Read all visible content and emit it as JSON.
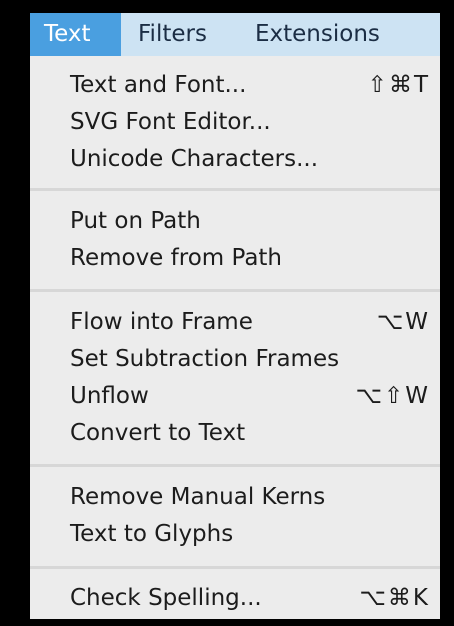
{
  "menubar": {
    "items": [
      {
        "label": "Text",
        "active": true
      },
      {
        "label": "Filters",
        "active": false
      },
      {
        "label": "Extensions",
        "active": false
      }
    ],
    "active_color": "#4a9fe0",
    "bar_color": "#cde3f3"
  },
  "menu": {
    "groups": [
      [
        {
          "label": "Text and Font...",
          "shortcut": "⇧⌘T"
        },
        {
          "label": "SVG Font Editor...",
          "shortcut": ""
        },
        {
          "label": "Unicode Characters...",
          "shortcut": ""
        }
      ],
      [
        {
          "label": "Put on Path",
          "shortcut": ""
        },
        {
          "label": "Remove from Path",
          "shortcut": ""
        }
      ],
      [
        {
          "label": "Flow into Frame",
          "shortcut": "⌥W"
        },
        {
          "label": "Set Subtraction Frames",
          "shortcut": ""
        },
        {
          "label": "Unflow",
          "shortcut": "⌥⇧W"
        },
        {
          "label": "Convert to Text",
          "shortcut": ""
        }
      ],
      [
        {
          "label": "Remove Manual Kerns",
          "shortcut": ""
        },
        {
          "label": "Text to Glyphs",
          "shortcut": ""
        }
      ],
      [
        {
          "label": "Check Spelling...",
          "shortcut": "⌥⌘K"
        }
      ]
    ]
  }
}
